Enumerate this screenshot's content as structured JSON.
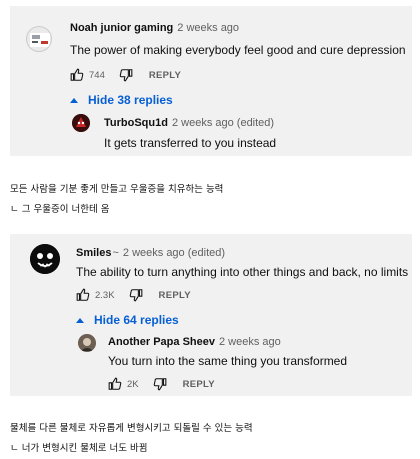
{
  "comment1": {
    "author": "Noah junior gaming",
    "time": "2 weeks ago",
    "text": "The power of making everybody feel good and cure depression",
    "like_count": "744",
    "reply_label": "REPLY",
    "hide_replies": "Hide 38 replies",
    "reply": {
      "author": "TurboSqu1d",
      "meta": "2 weeks ago (edited)",
      "text": "It gets transferred to you instead"
    }
  },
  "translation1": {
    "line1": "모든 사람을 기분 좋게 만들고 우울증을 치유하는 능력",
    "line2": "ㄴ 그 우울증이 너한테 옴"
  },
  "comment2": {
    "author": "Smiles",
    "author_decoration": "~",
    "meta": "2 weeks ago (edited)",
    "text": "The ability to turn anything into other things and back, no limits",
    "like_count": "2.3K",
    "reply_label": "REPLY",
    "hide_replies": "Hide 64 replies",
    "reply": {
      "author": "Another Papa Sheev",
      "time": "2 weeks ago",
      "text": "You turn into the same thing you transformed",
      "like_count": "2K",
      "reply_label": "REPLY"
    }
  },
  "translation2": {
    "line1": "물체를 다른 물체로 자유롭게 변형시키고 되돌릴 수 있는 능력",
    "line2": "ㄴ 너가 변형시킨 물체로 너도 바뀜"
  },
  "colors": {
    "link_blue": "#065fd4",
    "card_bg": "#f1f1f1",
    "meta_gray": "#606060"
  },
  "icons": [
    "thumbs-up-icon",
    "thumbs-down-icon",
    "caret-up-icon"
  ]
}
